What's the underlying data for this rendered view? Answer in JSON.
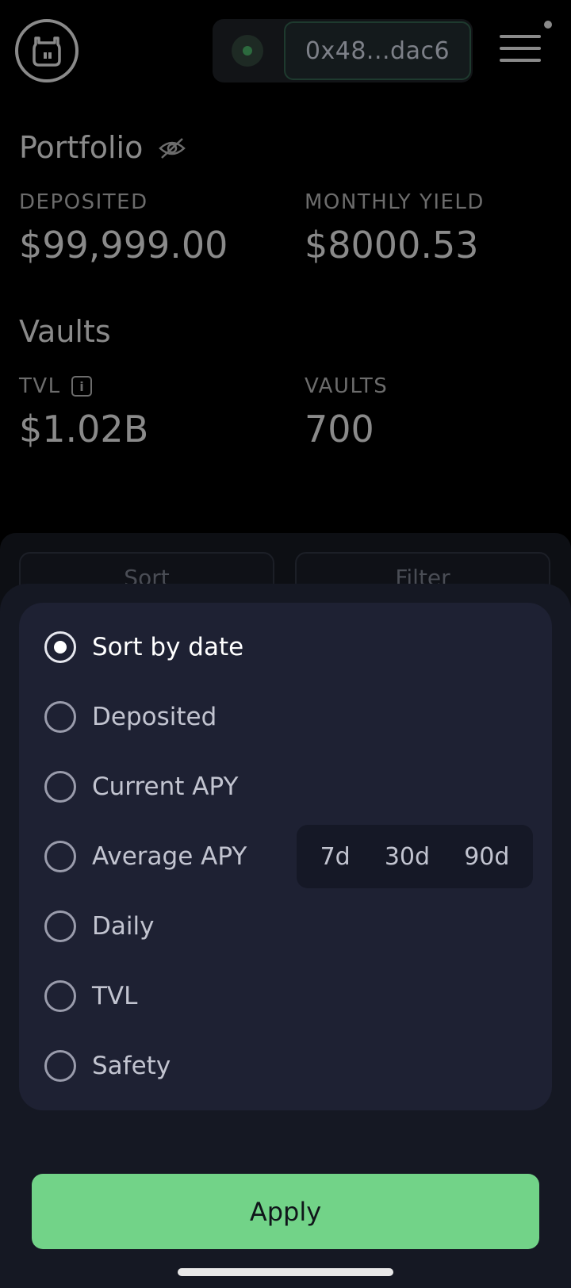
{
  "header": {
    "wallet_address": "0x48...dac6"
  },
  "portfolio": {
    "title": "Portfolio",
    "deposited_label": "DEPOSITED",
    "deposited_value": "$99,999.00",
    "monthly_yield_label": "MONTHLY YIELD",
    "monthly_yield_value": "$8000.53"
  },
  "vaults": {
    "title": "Vaults",
    "tvl_label": "TVL",
    "tvl_value": "$1.02B",
    "count_label": "VAULTS",
    "count_value": "700"
  },
  "toolbar": {
    "sort_label": "Sort",
    "filter_label": "Filter"
  },
  "sort_sheet": {
    "options": [
      {
        "label": "Sort by date",
        "selected": true
      },
      {
        "label": "Deposited",
        "selected": false
      },
      {
        "label": "Current APY",
        "selected": false
      },
      {
        "label": "Average APY",
        "selected": false
      },
      {
        "label": "Daily",
        "selected": false
      },
      {
        "label": "TVL",
        "selected": false
      },
      {
        "label": "Safety",
        "selected": false
      }
    ],
    "apy_periods": [
      "7d",
      "30d",
      "90d"
    ],
    "apply_label": "Apply"
  },
  "colors": {
    "accent": "#72d388",
    "sheet_bg": "#151823",
    "card_bg": "#1e2133"
  },
  "icons": {
    "logo": "giraffe-logo-icon",
    "menu": "hamburger-menu-icon",
    "hide": "eye-off-icon",
    "info": "info-icon"
  }
}
